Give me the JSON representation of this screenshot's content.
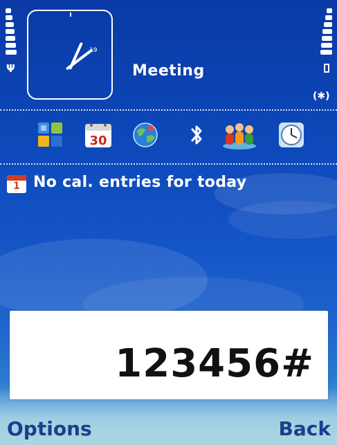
{
  "status": {
    "signal_level": 1.0,
    "battery_level": 1.0,
    "bluetooth_indicator": "(✱)"
  },
  "clock": {
    "date_label": "19"
  },
  "profile": {
    "name": "Meeting"
  },
  "shortcuts": [
    {
      "icon": "menu-grid-icon"
    },
    {
      "icon": "calendar-icon",
      "label": "30"
    },
    {
      "icon": "web-globe-icon"
    },
    {
      "icon": "bluetooth-icon"
    },
    {
      "icon": "contacts-icon"
    },
    {
      "icon": "clock-icon"
    }
  ],
  "calendar": {
    "icon_number": "1",
    "text": "No cal. entries for today"
  },
  "dialer": {
    "number": "123456#"
  },
  "softkeys": {
    "left": "Options",
    "right": "Back"
  },
  "colors": {
    "wallpaper_top": "#0a3aa6",
    "wallpaper_bottom": "#7fb3d8",
    "softkey_text": "#1a3f8c"
  }
}
